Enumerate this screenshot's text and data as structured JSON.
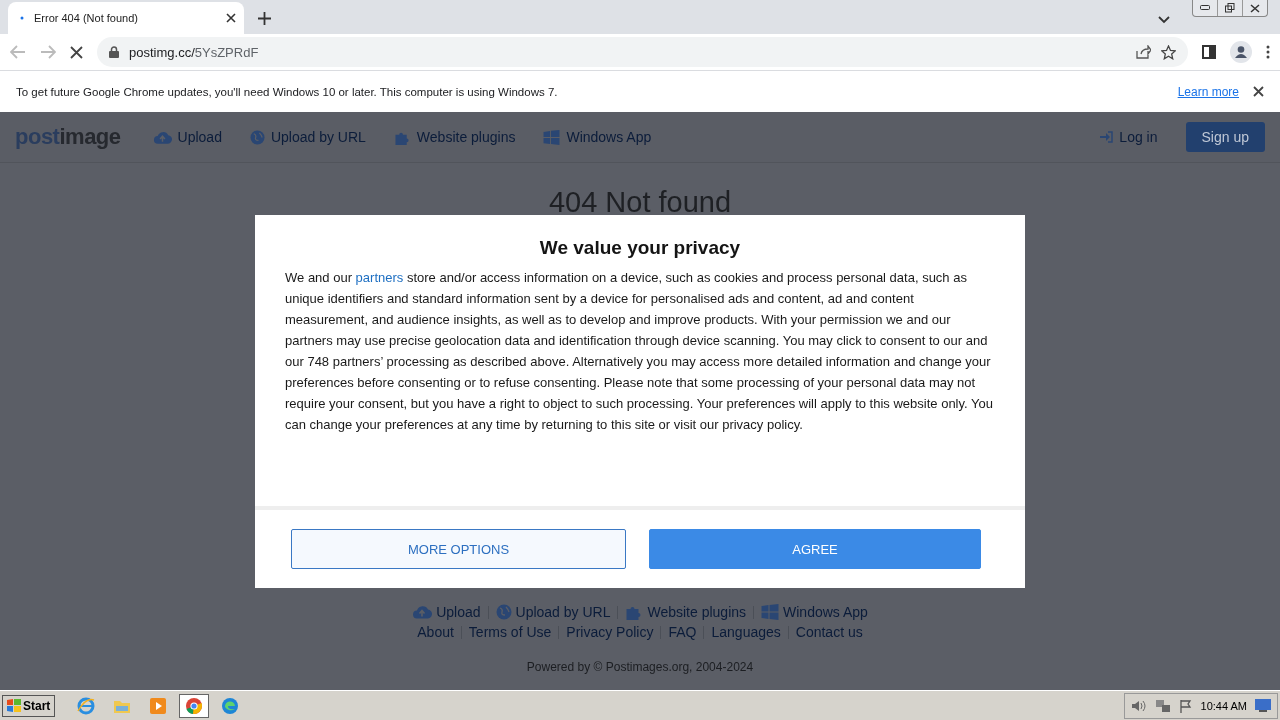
{
  "browser": {
    "tab": {
      "title": "Error 404 (Not found)"
    },
    "address": {
      "host": "postimg.cc/",
      "path": "5YsZPRdF"
    },
    "infobar": {
      "message": "To get future Google Chrome updates, you'll need Windows 10 or later. This computer is using Windows 7.",
      "link": "Learn more"
    }
  },
  "site": {
    "logo": {
      "first": "post",
      "second": "image"
    },
    "nav": [
      {
        "label": "Upload"
      },
      {
        "label": "Upload by URL"
      },
      {
        "label": "Website plugins"
      },
      {
        "label": "Windows App"
      }
    ],
    "login": "Log in",
    "signup": "Sign up",
    "heading": "404 Not found",
    "footer_nav": [
      {
        "label": "Upload"
      },
      {
        "label": "Upload by URL"
      },
      {
        "label": "Website plugins"
      },
      {
        "label": "Windows App"
      }
    ],
    "footer_links": [
      "About",
      "Terms of Use",
      "Privacy Policy",
      "FAQ",
      "Languages",
      "Contact us"
    ],
    "powered": "Powered by © Postimages.org, 2004-2024"
  },
  "consent": {
    "title": "We value your privacy",
    "before_link": "We and our ",
    "link": "partners",
    "body": " store and/or access information on a device, such as cookies and process personal data, such as unique identifiers and standard information sent by a device for personalised ads and content, ad and content measurement, and audience insights, as well as to develop and improve products. With your permission we and our partners may use precise geolocation data and identification through device scanning. You may click to consent to our and our 748 partners’ processing as described above. Alternatively you may access more detailed information and change your preferences before consenting or to refuse consenting. Please note that some processing of your personal data may not require your consent, but you have a right to object to such processing. Your preferences will apply to this website only. You can change your preferences at any time by returning to this site or visit our privacy policy.",
    "buttons": [
      {
        "label": "MORE OPTIONS",
        "kind": "secondary"
      },
      {
        "label": "AGREE",
        "kind": "primary"
      }
    ]
  },
  "taskbar": {
    "start": "Start",
    "apps": [
      {
        "selected": false
      },
      {
        "selected": false
      },
      {
        "selected": false
      },
      {
        "selected": true
      },
      {
        "selected": false
      }
    ],
    "clock": "10:44 AM"
  }
}
